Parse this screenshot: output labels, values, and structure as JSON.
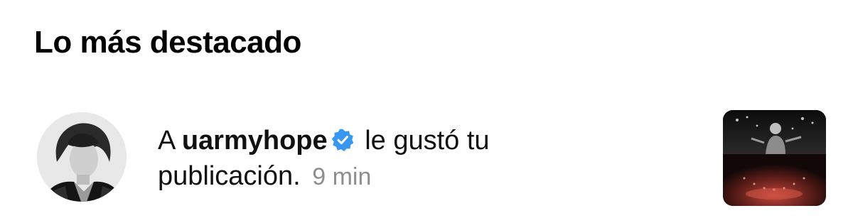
{
  "section": {
    "title": "Lo más destacado"
  },
  "notification": {
    "prefix": "A",
    "username": "uarmyhope",
    "action": "le gustó tu publicación.",
    "time": "9 min",
    "verified_color": "#3897f0"
  },
  "icons": {
    "verified": "verified-badge-icon",
    "avatar": "user-avatar",
    "thumbnail": "post-thumbnail"
  }
}
